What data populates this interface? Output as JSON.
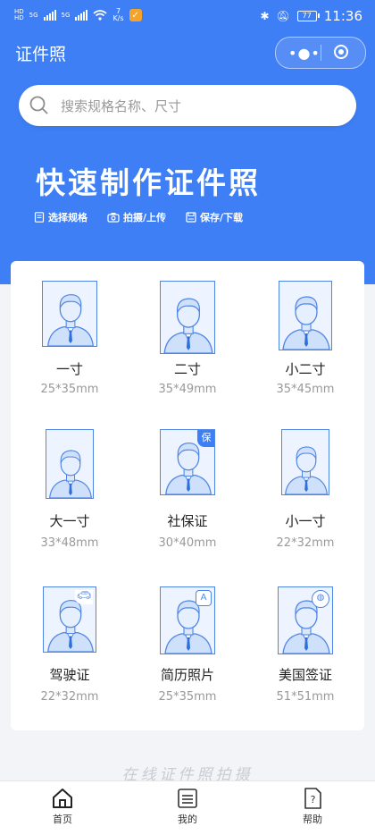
{
  "status_bar": {
    "left_tiny_top": "HD",
    "left_tiny_bottom": "HD",
    "net1": "5G",
    "net2": "5G",
    "speed_value": "7",
    "speed_unit": "K/s",
    "battery": "77",
    "time": "11:36"
  },
  "app_bar": {
    "title": "证件照"
  },
  "search": {
    "placeholder": "搜索规格名称、尺寸"
  },
  "hero": {
    "headline": "快速制作证件照",
    "steps": [
      "选择规格",
      "拍摄/上传",
      "保存/下载"
    ]
  },
  "items": [
    {
      "name": "一寸",
      "size": "25*35mm",
      "badge": ""
    },
    {
      "name": "二寸",
      "size": "35*49mm",
      "badge": ""
    },
    {
      "name": "小二寸",
      "size": "35*45mm",
      "badge": ""
    },
    {
      "name": "大一寸",
      "size": "33*48mm",
      "badge": ""
    },
    {
      "name": "社保证",
      "size": "30*40mm",
      "badge": "保"
    },
    {
      "name": "小一寸",
      "size": "22*32mm",
      "badge": ""
    },
    {
      "name": "驾驶证",
      "size": "22*32mm",
      "badge": "car-icon"
    },
    {
      "name": "简历照片",
      "size": "25*35mm",
      "badge": "A"
    },
    {
      "name": "美国签证",
      "size": "51*51mm",
      "badge": "globe-icon"
    }
  ],
  "slogan": "在线证件照拍摄",
  "tabbar": {
    "tabs": [
      {
        "label": "首页",
        "icon": "home-icon"
      },
      {
        "label": "我的",
        "icon": "list-icon"
      },
      {
        "label": "帮助",
        "icon": "help-icon"
      }
    ]
  },
  "colors": {
    "primary": "#3f7ff5",
    "photo_border": "#4f86e6"
  }
}
